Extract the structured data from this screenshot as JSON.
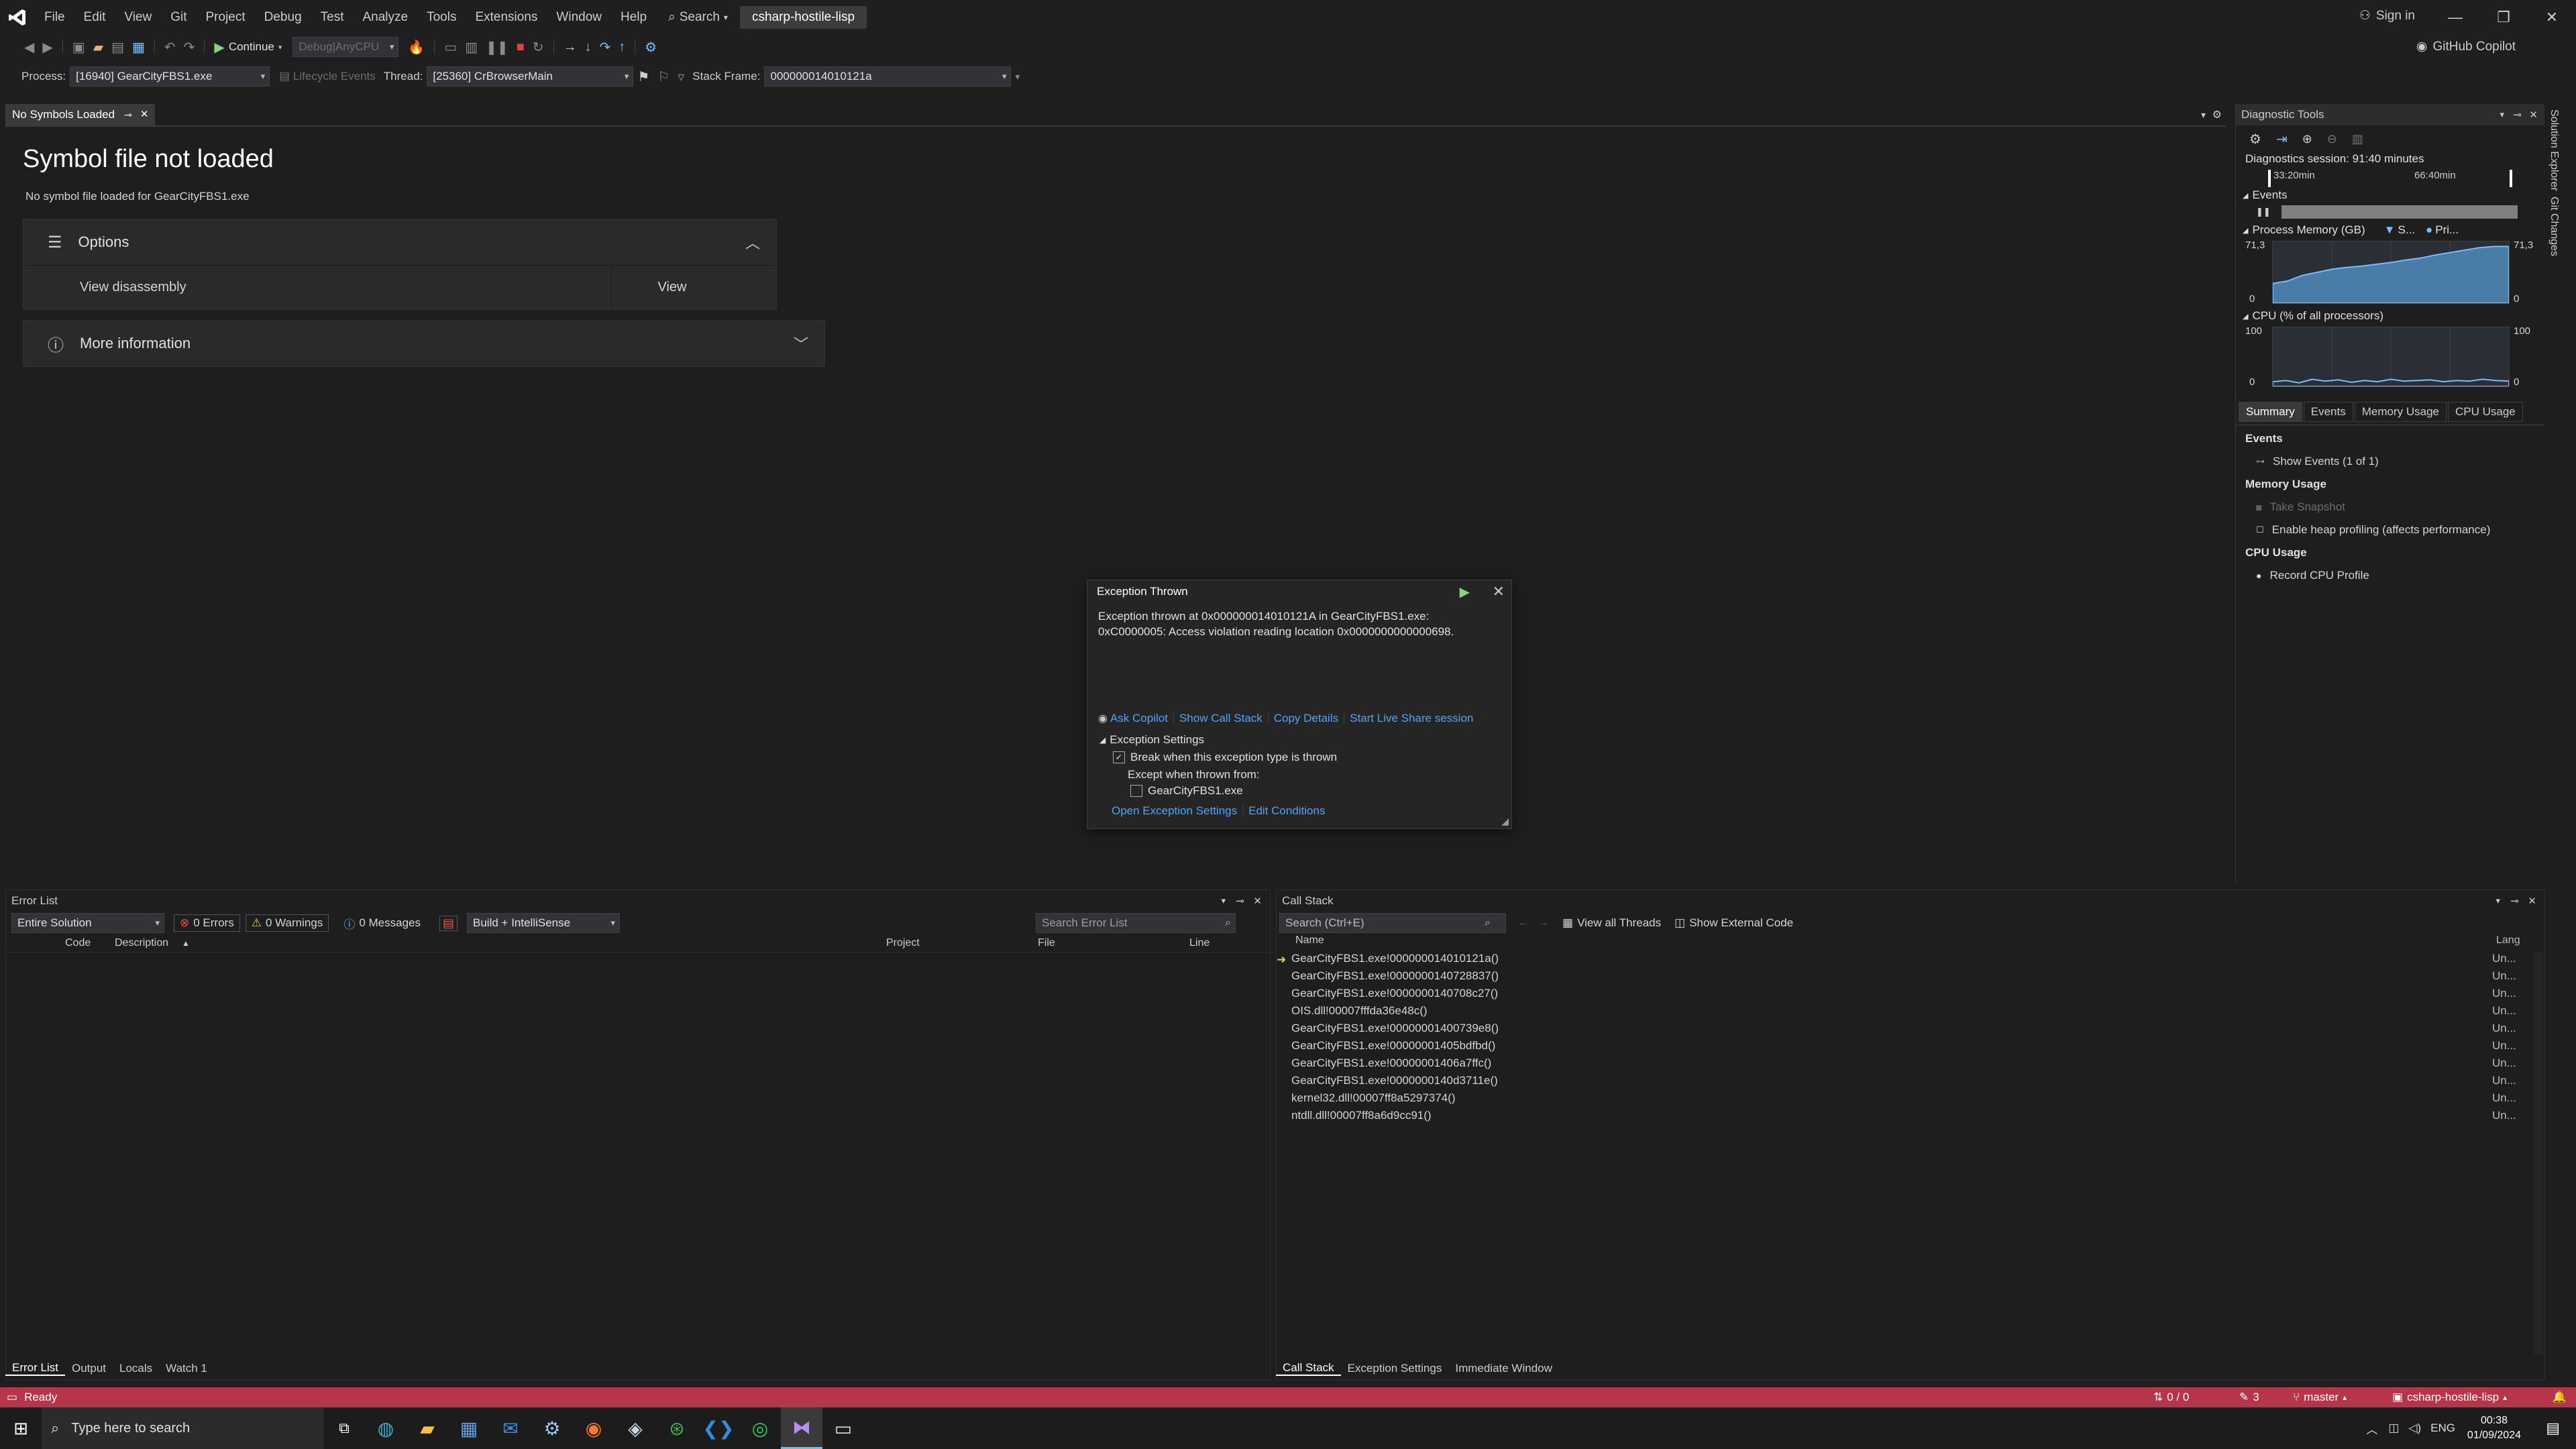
{
  "menubar": {
    "items": [
      "File",
      "Edit",
      "View",
      "Git",
      "Project",
      "Debug",
      "Test",
      "Analyze",
      "Tools",
      "Extensions",
      "Window",
      "Help"
    ],
    "search_label": "Search",
    "solution_name": "csharp-hostile-lisp",
    "sign_in": "Sign in"
  },
  "toolbar": {
    "continue_label": "Continue",
    "config": "Debug|AnyCPU",
    "github_copilot": "GitHub Copilot"
  },
  "debug_location": {
    "process_label": "Process:",
    "process_value": "[16940] GearCityFBS1.exe",
    "lifecycle_label": "Lifecycle Events",
    "thread_label": "Thread:",
    "thread_value": "[25360] CrBrowserMain",
    "stack_frame_label": "Stack Frame:",
    "stack_frame_value": "000000014010121a"
  },
  "doc_tab": {
    "label": "No Symbols Loaded"
  },
  "no_symbols": {
    "title": "Symbol file not loaded",
    "subtitle": "No symbol file loaded for GearCityFBS1.exe",
    "options_label": "Options",
    "view_disassembly": "View disassembly",
    "view_button": "View",
    "more_info": "More information"
  },
  "exception": {
    "title": "Exception Thrown",
    "message_line1": "Exception thrown at 0x000000014010121A in GearCityFBS1.exe:",
    "message_line2": "0xC0000005: Access violation reading location 0x0000000000000698.",
    "ask_copilot": "Ask Copilot",
    "show_call_stack": "Show Call Stack",
    "copy_details": "Copy Details",
    "start_live_share": "Start Live Share session",
    "settings_header": "Exception Settings",
    "break_when": "Break when this exception type is thrown",
    "break_checked": true,
    "except_when": "Except when thrown from:",
    "except_module": "GearCityFBS1.exe",
    "except_checked": false,
    "open_settings": "Open Exception Settings",
    "edit_conditions": "Edit Conditions"
  },
  "diagnostics": {
    "title": "Diagnostic Tools",
    "session": "Diagnostics session: 91:40 minutes",
    "tick1": "33:20min",
    "tick2": "66:40min",
    "events_label": "Events",
    "memory_label": "Process Memory (GB)",
    "memory_legend1": "S...",
    "memory_legend2": "Pri...",
    "mem_max": "71,3",
    "mem_min": "0",
    "cpu_label": "CPU (% of all processors)",
    "cpu_max": "100",
    "cpu_min": "0",
    "tabs": [
      "Summary",
      "Events",
      "Memory Usage",
      "CPU Usage"
    ],
    "events_header": "Events",
    "show_events": "Show Events (1 of 1)",
    "memory_header": "Memory Usage",
    "take_snapshot": "Take Snapshot",
    "heap_profiling": "Enable heap profiling (affects performance)",
    "cpu_header": "CPU Usage",
    "record_cpu": "Record CPU Profile",
    "memory_series": [
      0.32,
      0.36,
      0.45,
      0.5,
      0.55,
      0.58,
      0.6,
      0.63,
      0.66,
      0.7,
      0.73,
      0.78,
      0.82,
      0.86,
      0.9,
      0.92,
      0.92
    ],
    "cpu_series": [
      0.08,
      0.1,
      0.06,
      0.12,
      0.09,
      0.11,
      0.07,
      0.1,
      0.08,
      0.12,
      0.09,
      0.1,
      0.11,
      0.08,
      0.1,
      0.09,
      0.12,
      0.1,
      0.09
    ]
  },
  "error_list": {
    "title": "Error List",
    "scope": "Entire Solution",
    "errors": "0 Errors",
    "warnings": "0 Warnings",
    "messages": "0 Messages",
    "build_filter": "Build + IntelliSense",
    "search_placeholder": "Search Error List",
    "columns": [
      "Code",
      "Description",
      "Project",
      "File",
      "Line"
    ]
  },
  "call_stack": {
    "title": "Call Stack",
    "search_placeholder": "Search (Ctrl+E)",
    "view_all_threads": "View all Threads",
    "show_external": "Show External Code",
    "col_name": "Name",
    "col_lang": "Lang",
    "rows": [
      {
        "name": "GearCityFBS1.exe!000000014010121a()",
        "lang": "Un..."
      },
      {
        "name": "GearCityFBS1.exe!0000000140728837()",
        "lang": "Un..."
      },
      {
        "name": "GearCityFBS1.exe!0000000140708c27()",
        "lang": "Un..."
      },
      {
        "name": "OIS.dll!00007fffda36e48c()",
        "lang": "Un..."
      },
      {
        "name": "GearCityFBS1.exe!00000001400739e8()",
        "lang": "Un..."
      },
      {
        "name": "GearCityFBS1.exe!00000001405bdfbd()",
        "lang": "Un..."
      },
      {
        "name": "GearCityFBS1.exe!00000001406a7ffc()",
        "lang": "Un..."
      },
      {
        "name": "GearCityFBS1.exe!0000000140d3711e()",
        "lang": "Un..."
      },
      {
        "name": "kernel32.dll!00007ff8a5297374()",
        "lang": "Un..."
      },
      {
        "name": "ntdll.dll!00007ff8a6d9cc91()",
        "lang": "Un..."
      }
    ]
  },
  "bottom_tabs_left": [
    "Error List",
    "Output",
    "Locals",
    "Watch 1"
  ],
  "bottom_tabs_right": [
    "Call Stack",
    "Exception Settings",
    "Immediate Window"
  ],
  "side_tabs": [
    "Solution Explorer",
    "Git Changes"
  ],
  "status": {
    "ready": "Ready",
    "arrows": "0 / 0",
    "pencil": "3",
    "branch": "master",
    "repo": "csharp-hostile-lisp"
  },
  "taskbar": {
    "search_placeholder": "Type here to search",
    "lang": "ENG",
    "time": "00:38",
    "date": "01/09/2024"
  },
  "colors": {
    "statusbar": "#b5364a",
    "accent_blue": "#4da3ff",
    "graph_fill": "#4a7ca8"
  }
}
